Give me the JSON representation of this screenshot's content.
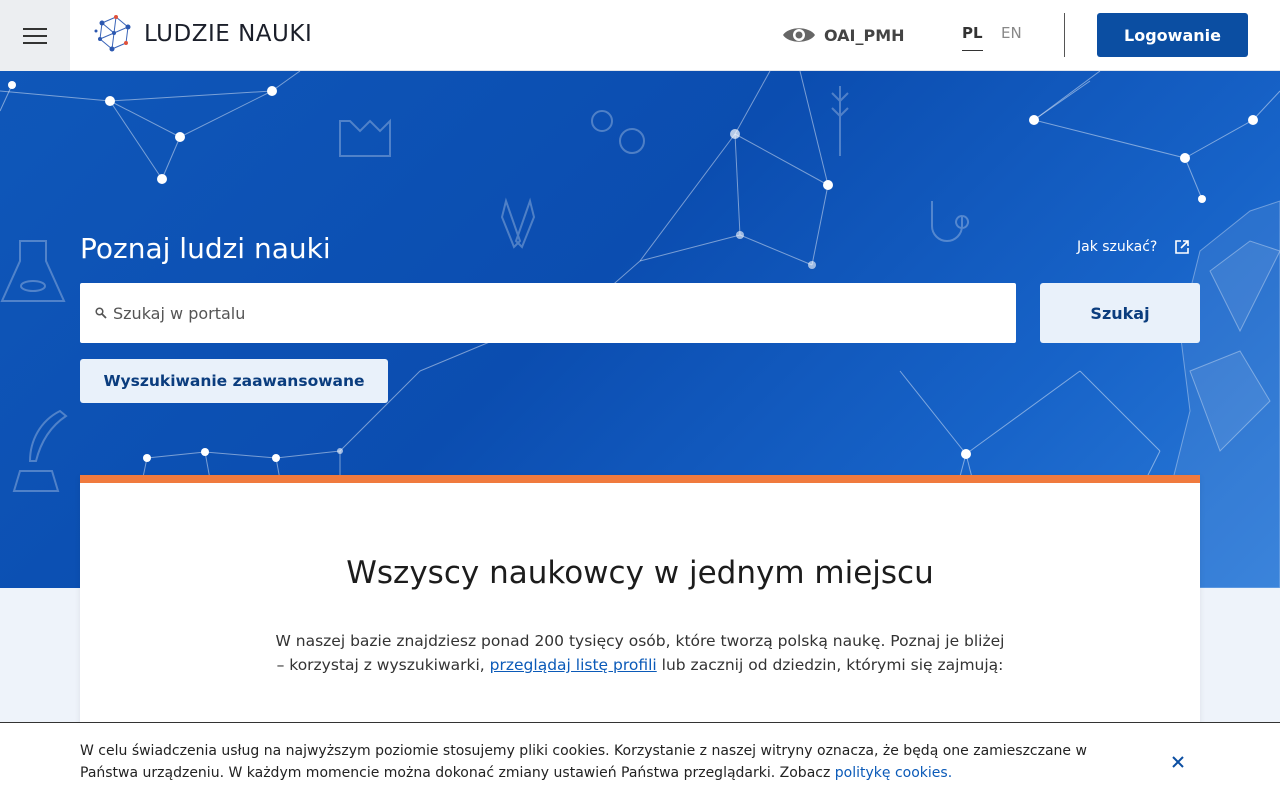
{
  "header": {
    "menu_icon": "hamburger-icon",
    "logo_text": "LUDZIE NAUKI",
    "oai_label": "OAI_PMH",
    "oai_icon": "eye-icon",
    "lang_pl": "PL",
    "lang_en": "EN",
    "login_label": "Logowanie"
  },
  "hero": {
    "title": "Poznaj ludzi nauki",
    "help_link": "Jak szukać?",
    "help_icon": "external-link-icon",
    "search_placeholder": "Szukaj w portalu",
    "search_icon": "search-icon",
    "search_button": "Szukaj",
    "advanced_button": "Wyszukiwanie zaawansowane"
  },
  "card": {
    "heading": "Wszyscy naukowcy w jednym miejscu",
    "text_before": "W naszej bazie znajdziesz ponad 200 tysięcy osób, które tworzą polską naukę. Poznaj je bliżej – korzystaj z wyszukiwarki, ",
    "link_text": "przeglądaj listę profili",
    "text_after": " lub zacznij od dziedzin, którymi się zajmują:"
  },
  "cookie": {
    "text": "W celu świadczenia usług na najwyższym poziomie stosujemy pliki cookies. Korzystanie z naszej witryny oznacza, że będą one zamieszczane w Państwa urządzeniu. W każdym momencie można dokonać zmiany ustawień Państwa przeglądarki. Zobacz ",
    "link_text": "politykę cookies.",
    "close_icon": "close-icon"
  },
  "colors": {
    "brand_blue": "#0b4ea2",
    "accent_orange": "#f07a3e"
  }
}
